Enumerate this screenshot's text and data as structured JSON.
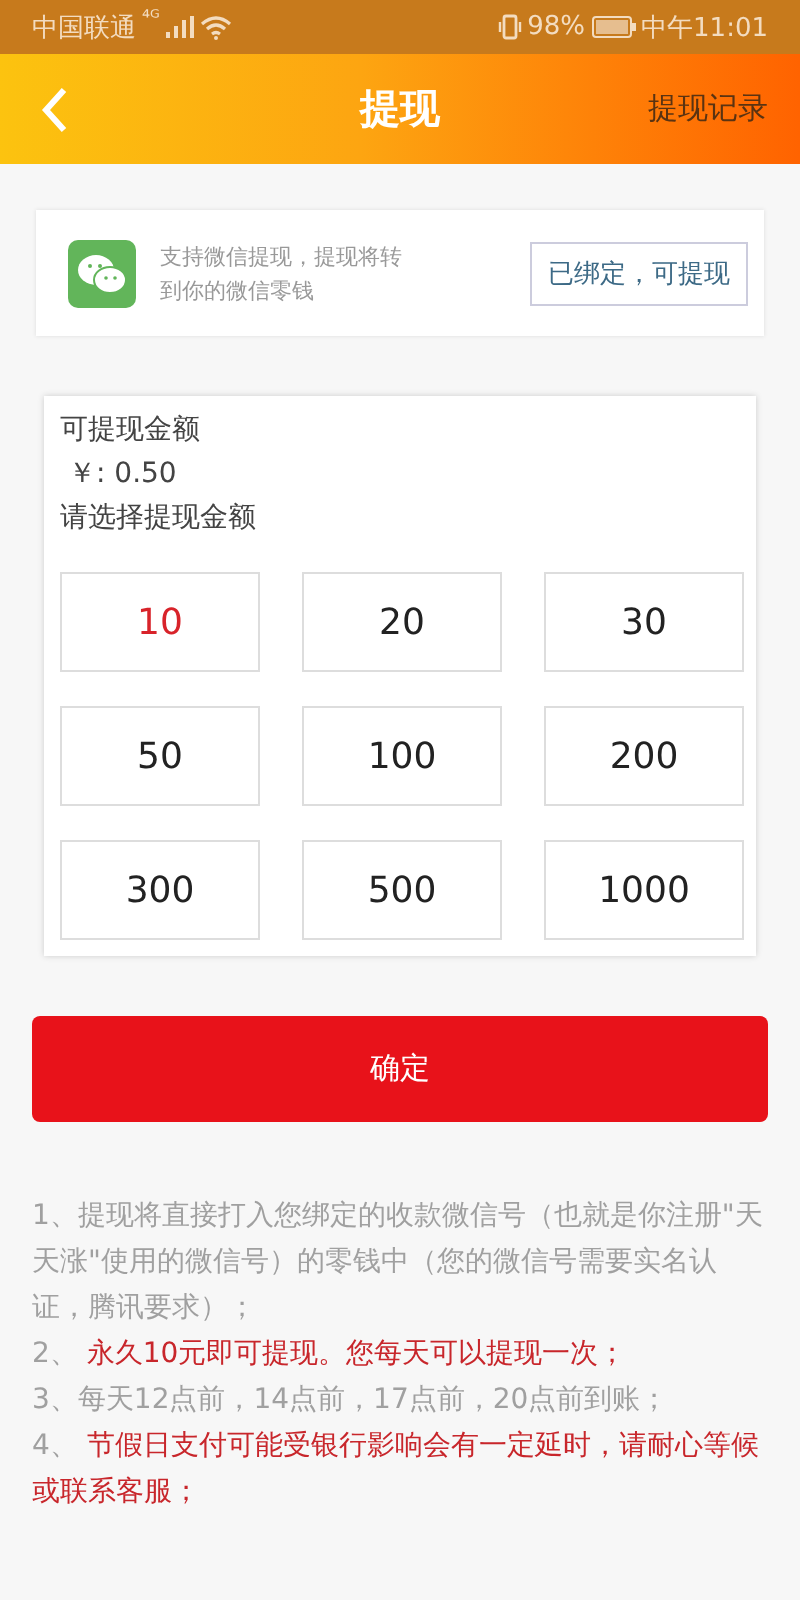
{
  "status_bar": {
    "carrier": "中国联通",
    "network": "⁴ᴳ",
    "battery": "98%",
    "time": "中午11:01"
  },
  "header": {
    "title": "提现",
    "action": "提现记录"
  },
  "wechat": {
    "description": "支持微信提现，提现将转到你的微信零钱",
    "status": "已绑定，可提现"
  },
  "amount": {
    "label": "可提现金额",
    "balance": "￥: 0.50",
    "prompt": "请选择提现金额",
    "options": [
      {
        "value": "10",
        "selected": true
      },
      {
        "value": "20",
        "selected": false
      },
      {
        "value": "30",
        "selected": false
      },
      {
        "value": "50",
        "selected": false
      },
      {
        "value": "100",
        "selected": false
      },
      {
        "value": "200",
        "selected": false
      },
      {
        "value": "300",
        "selected": false
      },
      {
        "value": "500",
        "selected": false
      },
      {
        "value": "1000",
        "selected": false
      }
    ]
  },
  "confirm": "确定",
  "notes": [
    {
      "number": "1、",
      "text": "提现将直接打入您绑定的收款微信号（也就是你注册\"天天涨\"使用的微信号）的零钱中（您的微信号需要实名认证，腾讯要求）；",
      "highlight": false
    },
    {
      "number": "2、",
      "text": " 永久10元即可提现。您每天可以提现一次；",
      "highlight": true
    },
    {
      "number": "3、",
      "text": "每天12点前，14点前，17点前，20点前到账；",
      "highlight": false
    },
    {
      "number": "4、",
      "text": " 节假日支付可能受银行影响会有一定延时，请耐心等候或联系客服；",
      "highlight": true
    }
  ]
}
